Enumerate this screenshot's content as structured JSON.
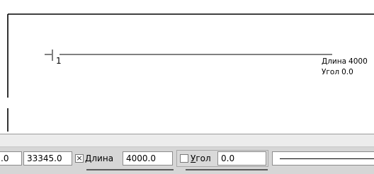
{
  "canvas": {
    "point_label": "1",
    "hint": {
      "length_label": "Длина",
      "length_value": "4000",
      "angle_label": "Угол",
      "angle_value": "0.0"
    }
  },
  "panel": {
    "x_value": ".0",
    "y_value": "33345.0",
    "length": {
      "checked": true,
      "check_glyph": "×",
      "label_mnemonic": "Д",
      "label_rest": "лина",
      "value": "4000.0"
    },
    "angle": {
      "checked": false,
      "label_mnemonic": "У",
      "label_rest": "гол",
      "value": "0.0"
    },
    "line_style_icon": "solid-line-sample"
  }
}
